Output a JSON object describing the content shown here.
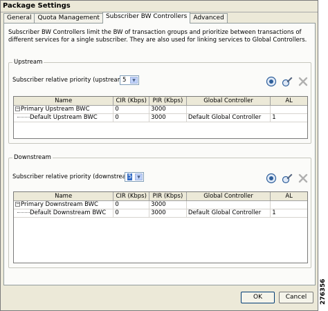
{
  "window": {
    "title": "Package Settings"
  },
  "tabs": [
    {
      "label": "General"
    },
    {
      "label": "Quota Management"
    },
    {
      "label": "Subscriber BW Controllers",
      "active": true
    },
    {
      "label": "Advanced"
    }
  ],
  "description": "Subscriber BW Controllers limit the BW of transaction groups and prioritize between transactions of different services for a single subscriber. They are also used for linking services to Global Controllers.",
  "columns": [
    "Name",
    "CIR (Kbps)",
    "PIR (Kbps)",
    "Global Controller",
    "AL"
  ],
  "upstream": {
    "title": "Upstream",
    "priority_label": "Subscriber relative priority (upstream):",
    "priority_value": "5",
    "rows": [
      {
        "name": "Primary Upstream BWC",
        "cir": "0",
        "pir": "3000",
        "gc": "",
        "al": ""
      },
      {
        "name": "Default Upstream BWC",
        "cir": "0",
        "pir": "3000",
        "gc": "Default Global Controller",
        "al": "1"
      }
    ]
  },
  "downstream": {
    "title": "Downstream",
    "priority_label": "Subscriber relative priority (downstream):",
    "priority_value": "5",
    "rows": [
      {
        "name": "Primary Downstream BWC",
        "cir": "0",
        "pir": "3000",
        "gc": "",
        "al": ""
      },
      {
        "name": "Default Downstream BWC",
        "cir": "0",
        "pir": "3000",
        "gc": "Default Global Controller",
        "al": "1"
      }
    ]
  },
  "buttons": {
    "ok": "OK",
    "cancel": "Cancel"
  },
  "figure_id": "276356",
  "colors": {
    "tab_border": "#919b9c",
    "selection": "#316ac5",
    "button_border": "#003c74"
  }
}
